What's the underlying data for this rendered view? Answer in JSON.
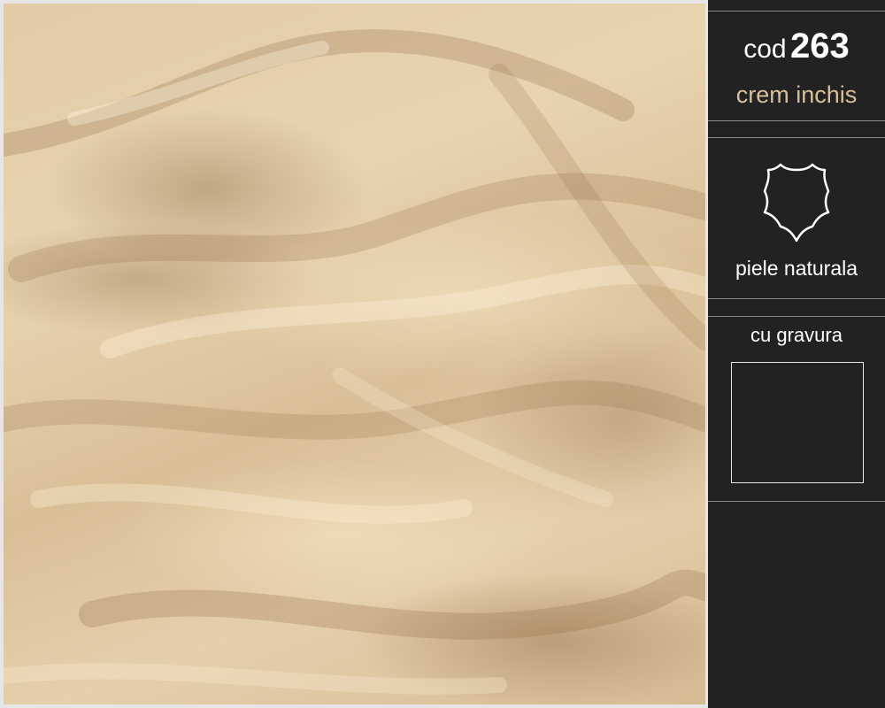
{
  "product": {
    "code_prefix": "cod",
    "code_number": "263",
    "color_name": "crem inchis",
    "material_icon": "leather-hide-icon",
    "material": "piele naturala",
    "engraving_label": "cu gravura"
  },
  "photo": {
    "subject": "draped cream leather",
    "dominant_color": "#e2cba6"
  },
  "colors": {
    "panel_background": "#222222",
    "accent_text": "#d8bf98",
    "primary_text": "#ffffff",
    "frame": "#e6e6e6"
  }
}
